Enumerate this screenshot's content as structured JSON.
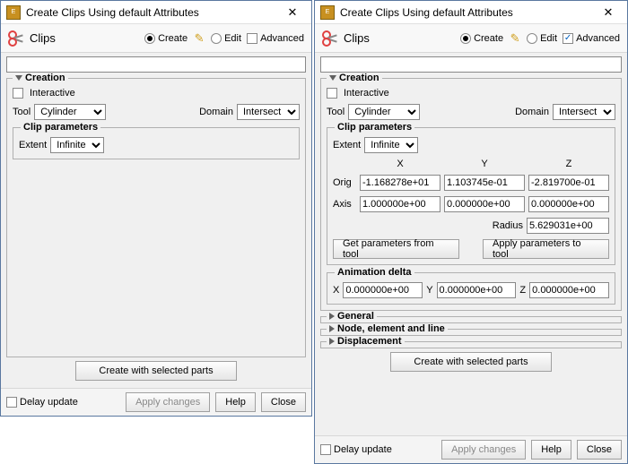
{
  "left": {
    "title": "Create Clips Using default Attributes",
    "section": "Clips",
    "mode_create": "Create",
    "mode_edit": "Edit",
    "mode_advanced": "Advanced",
    "advanced_checked": false,
    "filter_value": "",
    "creation_label": "Creation",
    "interactive_label": "Interactive",
    "tool_label": "Tool",
    "tool_value": "Cylinder",
    "domain_label": "Domain",
    "domain_value": "Intersect",
    "clip_params_label": "Clip parameters",
    "extent_label": "Extent",
    "extent_value": "Infinite",
    "btn_create": "Create with selected parts",
    "delay_label": "Delay update",
    "btn_apply": "Apply changes",
    "btn_help": "Help",
    "btn_close": "Close"
  },
  "right": {
    "title": "Create Clips Using default Attributes",
    "section": "Clips",
    "mode_create": "Create",
    "mode_edit": "Edit",
    "mode_advanced": "Advanced",
    "advanced_checked": true,
    "filter_value": "",
    "creation_label": "Creation",
    "interactive_label": "Interactive",
    "tool_label": "Tool",
    "tool_value": "Cylinder",
    "domain_label": "Domain",
    "domain_value": "Intersect",
    "clip_params_label": "Clip parameters",
    "extent_label": "Extent",
    "extent_value": "Infinite",
    "col_x": "X",
    "col_y": "Y",
    "col_z": "Z",
    "orig_label": "Orig",
    "orig_x": "-1.168278e+01",
    "orig_y": "1.103745e-01",
    "orig_z": "-2.819700e-01",
    "axis_label": "Axis",
    "axis_x": "1.000000e+00",
    "axis_y": "0.000000e+00",
    "axis_z": "0.000000e+00",
    "radius_label": "Radius",
    "radius_value": "5.629031e+00",
    "btn_get_params": "Get parameters from tool",
    "btn_apply_params": "Apply parameters to tool",
    "anim_label": "Animation delta",
    "anim_x_label": "X",
    "anim_y_label": "Y",
    "anim_z_label": "Z",
    "anim_x": "0.000000e+00",
    "anim_y": "0.000000e+00",
    "anim_z": "0.000000e+00",
    "general_label": "General",
    "node_label": "Node, element and line",
    "disp_label": "Displacement",
    "btn_create": "Create with selected parts",
    "delay_label": "Delay update",
    "btn_apply": "Apply changes",
    "btn_help": "Help",
    "btn_close": "Close"
  }
}
